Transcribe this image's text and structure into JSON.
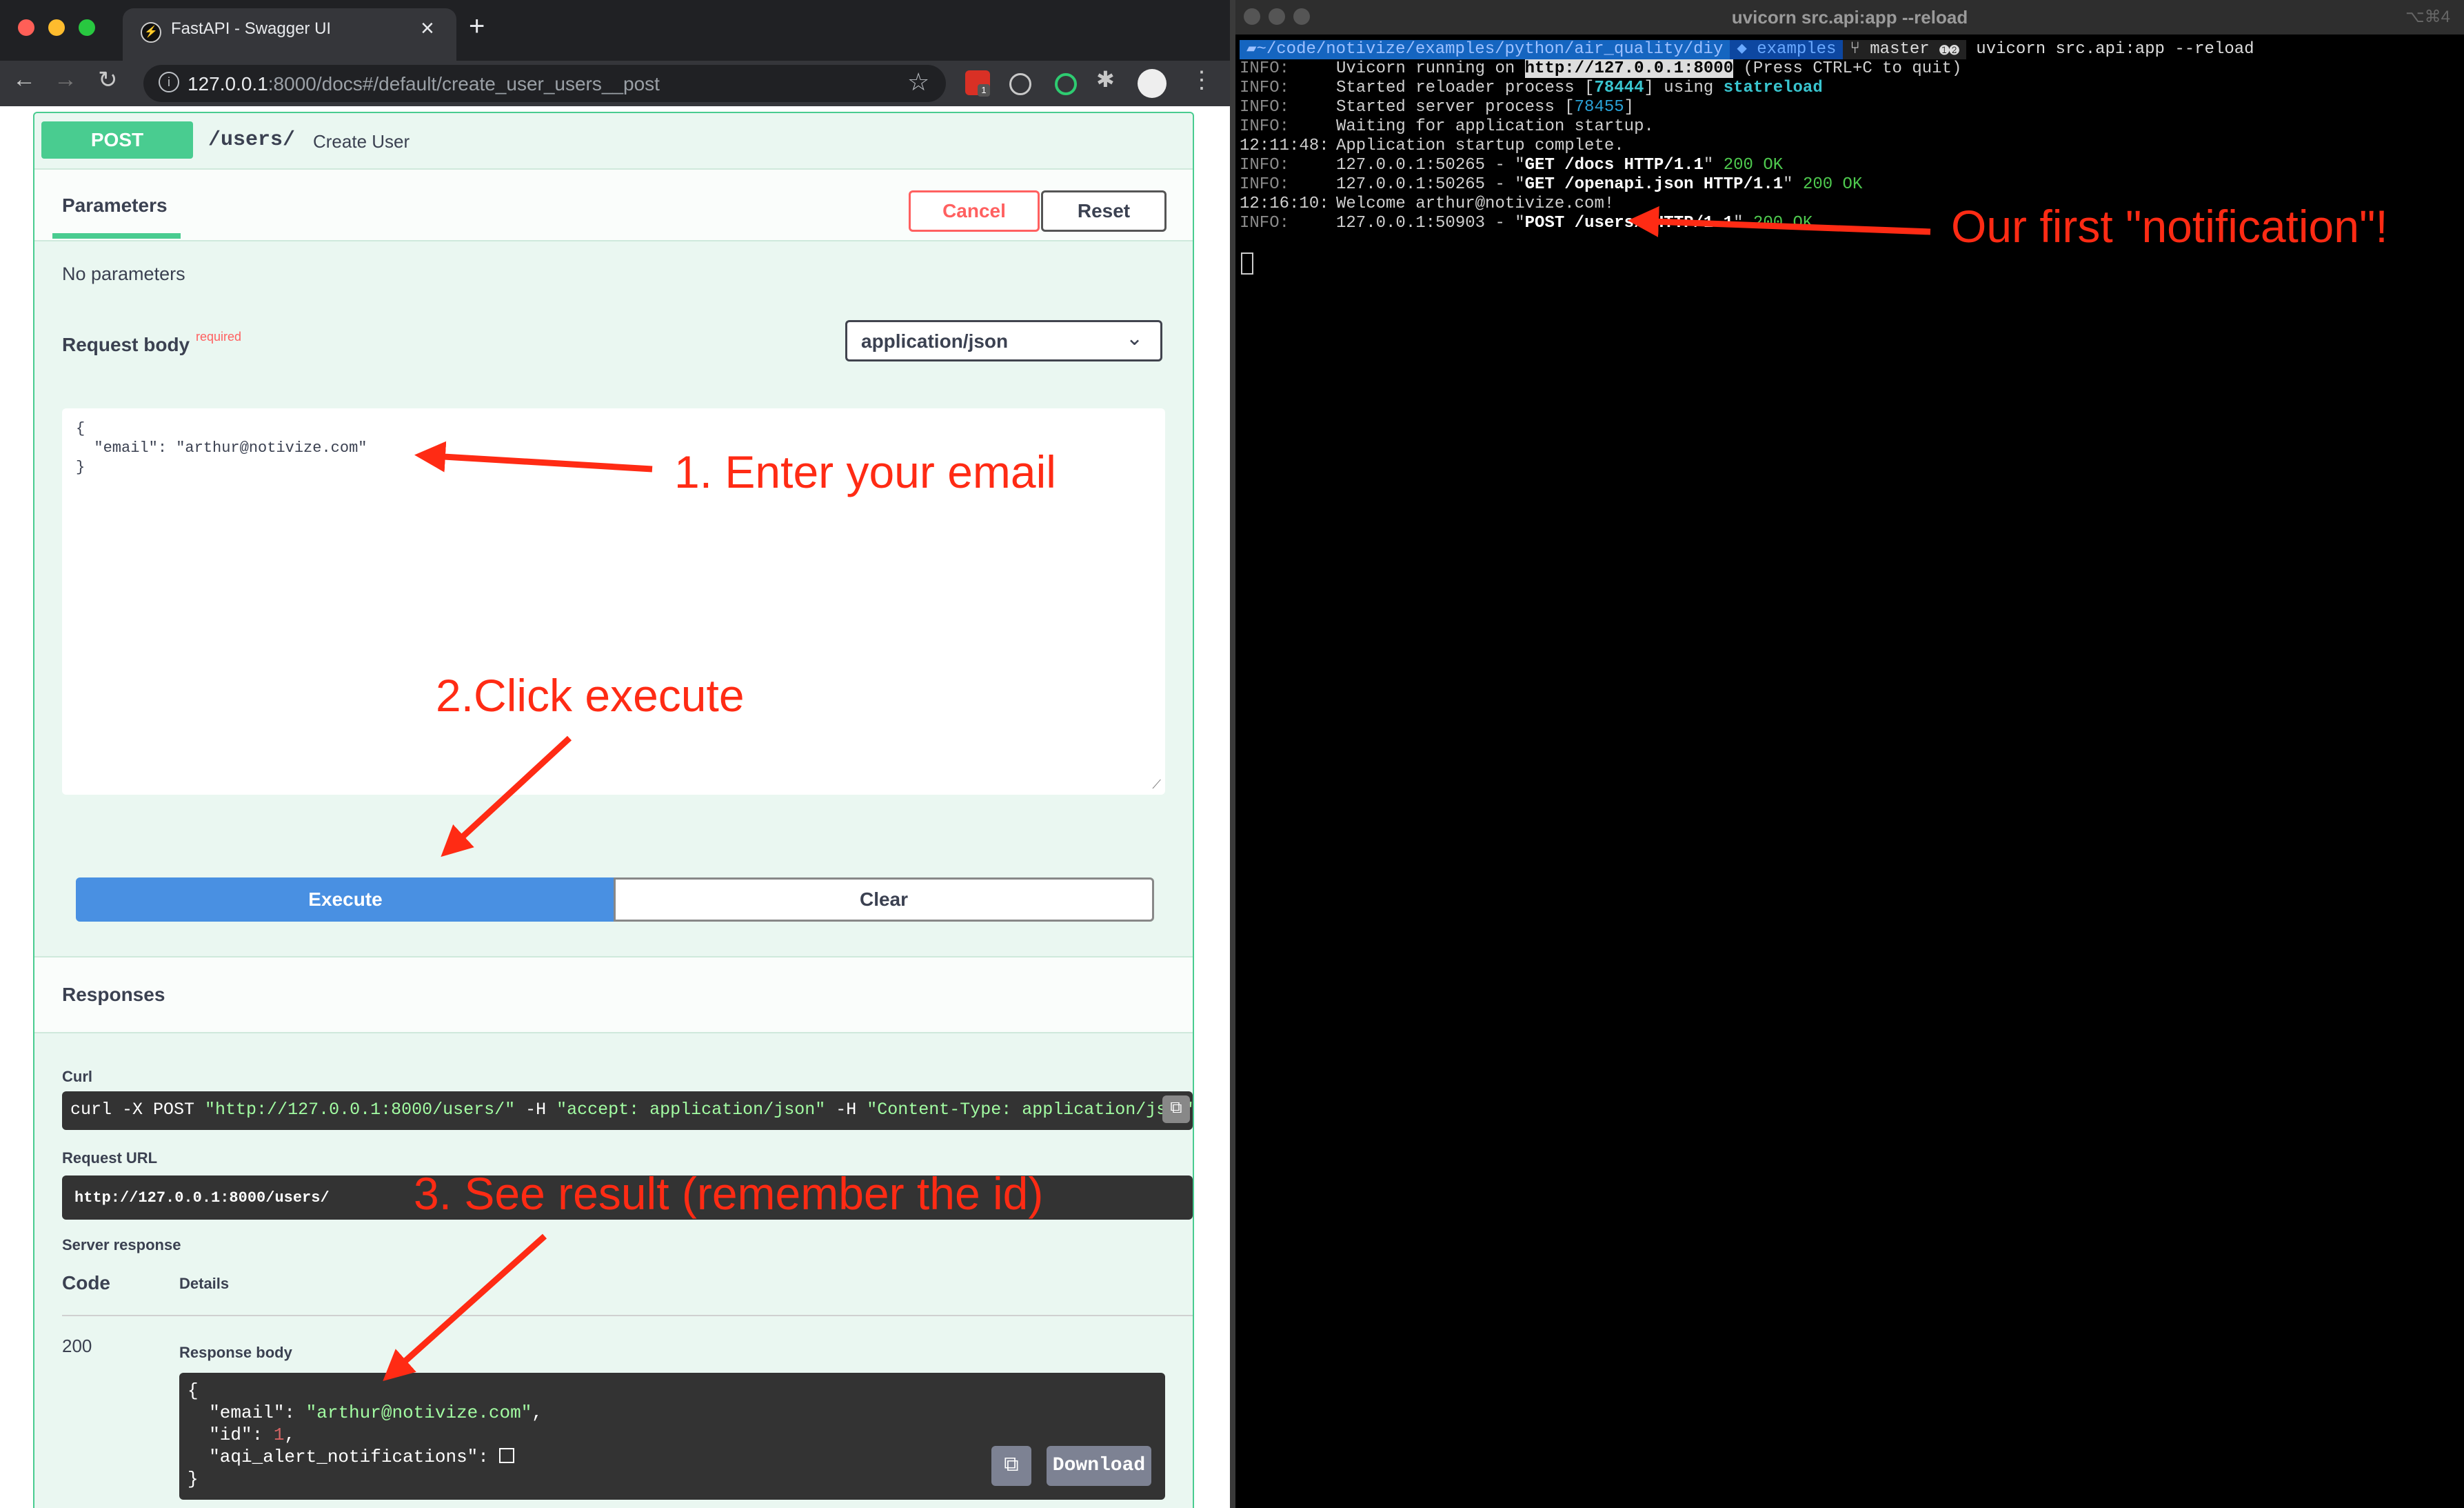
{
  "browser": {
    "tab_title": "FastAPI - Swagger UI",
    "tab_close": "×",
    "new_tab": "+",
    "url_host": "127.0.0.1",
    "url_rest": ":8000/docs#/default/create_user_users__post",
    "extension_badge": "1"
  },
  "operation": {
    "method": "POST",
    "path": "/users/",
    "summary": "Create User",
    "parameters_title": "Parameters",
    "cancel_label": "Cancel",
    "reset_label": "Reset",
    "no_params": "No parameters",
    "request_body_title": "Request body",
    "required_label": "required",
    "content_type": "application/json",
    "request_body_json": "{\n  \"email\": \"arthur@notivize.com\"\n}",
    "execute_label": "Execute",
    "clear_label": "Clear"
  },
  "responses": {
    "title": "Responses",
    "curl_label": "Curl",
    "curl_cmd": "curl -X POST ",
    "curl_url": "\"http://127.0.0.1:8000/users/\"",
    "curl_h1": " -H  ",
    "curl_accept": "\"accept: application/json\"",
    "curl_h2": " -H  ",
    "curl_ct": "\"Content-Type: application/json\"",
    "request_url_label": "Request URL",
    "request_url": "http://127.0.0.1:8000/users/",
    "server_response_label": "Server response",
    "code_header": "Code",
    "details_header": "Details",
    "code": "200",
    "response_body_label": "Response body",
    "body_open": "{",
    "email_key": "  \"email\": ",
    "email_val": "\"arthur@notivize.com\"",
    "id_key": "  \"id\": ",
    "id_val": "1",
    "aqi_key": "  \"aqi_alert_notifications\": ",
    "body_close": "}",
    "download_label": "Download"
  },
  "annotations": {
    "step1": "1. Enter your email",
    "step2": "2.Click execute",
    "step3": "3. See result (remember the id)",
    "terminal_note": "Our first \"notification\"!"
  },
  "terminal": {
    "title": "uvicorn src.api:app --reload",
    "shortcut": "⌥⌘4",
    "prompt_path": "~/code/notivize/examples/python/air_quality/diy",
    "prompt_repo": "examples",
    "prompt_branch": "master",
    "prompt_command": "uvicorn src.api:app --reload",
    "lines": [
      {
        "prefix": "INFO:",
        "text": "Uvicorn running on ",
        "hl": "http://127.0.0.1:8000",
        "after": " (Press CTRL+C to quit)"
      },
      {
        "prefix": "INFO:",
        "text": "Started reloader process [",
        "num": "78444",
        "after": "] using ",
        "bold": "statreload"
      },
      {
        "prefix": "INFO:",
        "text": "Started server process [",
        "num": "78455",
        "after": "]"
      },
      {
        "prefix": "INFO:",
        "text": "Waiting for application startup."
      },
      {
        "prefix": "12:11:48:",
        "text": "Application startup complete."
      },
      {
        "prefix": "INFO:",
        "text": "127.0.0.1:50265 - \"",
        "req": "GET /docs HTTP/1.1",
        "after": "\" ",
        "status": "200 OK"
      },
      {
        "prefix": "INFO:",
        "text": "127.0.0.1:50265 - \"",
        "req": "GET /openapi.json HTTP/1.1",
        "after": "\" ",
        "status": "200 OK"
      },
      {
        "prefix": "12:16:10:",
        "text": "Welcome arthur@notivize.com!"
      },
      {
        "prefix": "INFO:",
        "text": "127.0.0.1:50903 - \"",
        "req": "POST /users/ HTTP/1.1",
        "after": "\" ",
        "status": "200 OK"
      }
    ]
  },
  "colors": {
    "post_green": "#49cc90",
    "execute_blue": "#4990e2",
    "annotation_red": "#ff2b14"
  }
}
